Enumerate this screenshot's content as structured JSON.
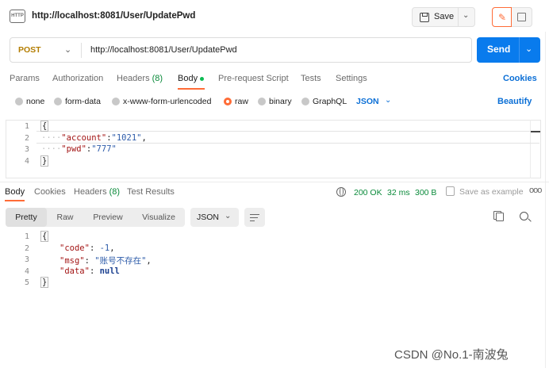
{
  "header": {
    "badge": "HTTP",
    "title": "http://localhost:8081/User/UpdatePwd",
    "save_label": "Save"
  },
  "request": {
    "method": "POST",
    "url": "http://localhost:8081/User/UpdatePwd",
    "send_label": "Send"
  },
  "request_tabs": {
    "params": "Params",
    "authorization": "Authorization",
    "headers": "Headers",
    "headers_count": "(8)",
    "body": "Body",
    "pre_request": "Pre-request Script",
    "tests": "Tests",
    "settings": "Settings",
    "cookies": "Cookies"
  },
  "body_types": {
    "none": "none",
    "form_data": "form-data",
    "urlencoded": "x-www-form-urlencoded",
    "raw": "raw",
    "binary": "binary",
    "graphql": "GraphQL",
    "format": "JSON",
    "beautify": "Beautify"
  },
  "request_body": {
    "line_numbers": [
      "1",
      "2",
      "3",
      "4"
    ],
    "open": "{",
    "dots2": "····",
    "key1": "\"account\"",
    "colon1": ":",
    "val1": "\"1021\"",
    "comma1": ",",
    "dots3": "····",
    "key2": "\"pwd\"",
    "colon2": ":",
    "val2": "\"777\"",
    "close": "}"
  },
  "response_tabs": {
    "body": "Body",
    "cookies": "Cookies",
    "headers": "Headers",
    "headers_count": "(8)",
    "test_results": "Test Results",
    "status": "200 OK",
    "time": "32 ms",
    "size": "300 B",
    "save_example": "Save as example",
    "more": "ooo"
  },
  "view_modes": {
    "pretty": "Pretty",
    "raw": "Raw",
    "preview": "Preview",
    "visualize": "Visualize",
    "format": "JSON"
  },
  "response_body": {
    "line_numbers": [
      "1",
      "2",
      "3",
      "4",
      "5"
    ],
    "open": "{",
    "key1": "\"code\"",
    "sep1": ": ",
    "val1": "-1",
    "comma1": ",",
    "key2": "\"msg\"",
    "sep2": ": ",
    "val2": "\"账号不存在\"",
    "comma2": ",",
    "key3": "\"data\"",
    "sep3": ": ",
    "val3": "null",
    "close": "}"
  },
  "watermark": "CSDN @No.1-南波兔",
  "colors": {
    "accent": "#ff6c37",
    "send": "#097bed",
    "link": "#0b6fd6",
    "success": "#0a8a3a",
    "json_key": "#a31515",
    "json_value": "#2e5caa"
  }
}
